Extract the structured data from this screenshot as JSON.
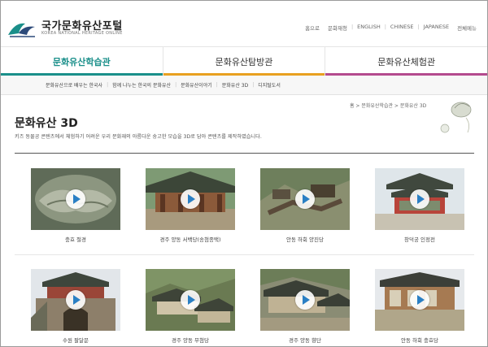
{
  "header": {
    "logo_title": "국가문화유산포털",
    "logo_subtitle": "KOREA NATIONAL HERITAGE ONLINE",
    "util_links": [
      "홈으로",
      "문화재청",
      "ENGLISH",
      "CHINESE",
      "JAPANESE",
      "전체메뉴"
    ]
  },
  "mainnav": {
    "tabs": [
      {
        "label": "문화유산학습관",
        "color": "#1a8f8a",
        "active": true
      },
      {
        "label": "문화유산탐방관",
        "color": "#e8a020",
        "active": false
      },
      {
        "label": "문화유산체험관",
        "color": "#b44a8e",
        "active": false
      }
    ]
  },
  "subnav": {
    "items": [
      "문화유산으로 배우는 한국사",
      "함께 나누는 한국의 문화유산",
      "문화유산이야기",
      "문화유산 3D",
      "디지털도서"
    ]
  },
  "content": {
    "title": "문화유산 3D",
    "breadcrumb": "홈 > 문화유산학습관 > 문화유산 3D",
    "description": "키즈 동물공 콘텐츠에서 체험하기 어려운 우리 문화재의 아름다운 숭고한 모습을 3D로 담아 콘텐츠를 제작하였습니다."
  },
  "items": [
    {
      "caption": "충효 절경"
    },
    {
      "caption": "경주 양동 서백당(송첨종택)"
    },
    {
      "caption": "안동 하회 양진당"
    },
    {
      "caption": "창덕궁 인정전"
    },
    {
      "caption": "수원 팔달문"
    },
    {
      "caption": "경주 양동 무첨당"
    },
    {
      "caption": "경주 양동 향단"
    },
    {
      "caption": "안동 하회 충효당"
    }
  ],
  "colors": {
    "accent": "#1a8f8a",
    "play": "#2a7fc4"
  }
}
